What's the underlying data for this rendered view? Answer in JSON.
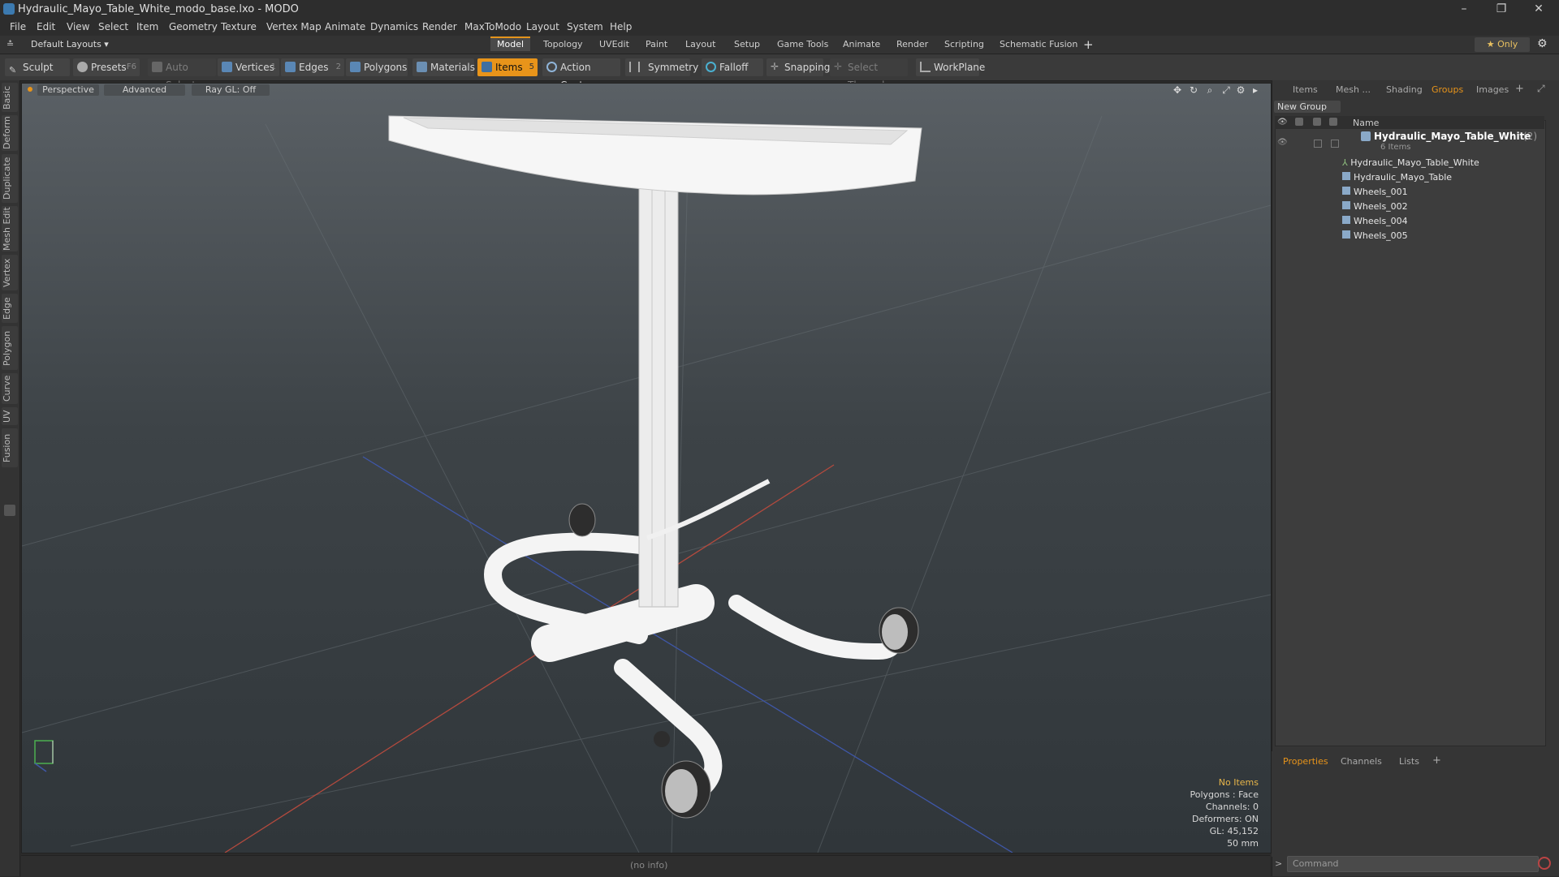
{
  "window": {
    "title": "Hydraulic_Mayo_Table_White_modo_base.lxo - MODO",
    "minimize": "–",
    "restore": "❐",
    "close": "✕"
  },
  "menu": [
    "File",
    "Edit",
    "View",
    "Select",
    "Item",
    "Geometry",
    "Texture",
    "Vertex Map",
    "Animate",
    "Dynamics",
    "Render",
    "MaxToModo",
    "Layout",
    "System",
    "Help"
  ],
  "layout_selector": "Default Layouts ▾",
  "layout_tabs": [
    "Model",
    "Topology",
    "UVEdit",
    "Paint",
    "Layout",
    "Setup",
    "Game Tools",
    "Animate",
    "Render",
    "Scripting",
    "Schematic Fusion"
  ],
  "active_layout_tab": "Model",
  "only_label": "★  Only",
  "toolbar": {
    "sculpt": "Sculpt",
    "presets": "Presets",
    "presets_key": "F6",
    "auto_select": "Auto Select",
    "vertices": "Vertices",
    "vertices_key": "1",
    "edges": "Edges",
    "edges_key": "2",
    "polygons": "Polygons",
    "materials": "Materials",
    "items": "Items",
    "items_key": "5",
    "action_center": "Action Center",
    "symmetry": "Symmetry",
    "falloff": "Falloff",
    "snapping": "Snapping",
    "select_through": "Select Through",
    "workplane": "WorkPlane"
  },
  "left_tabs": [
    "Basic",
    "Deform",
    "Duplicate",
    "Mesh Edit",
    "Vertex",
    "Edge",
    "Polygon",
    "Curve",
    "UV",
    "Fusion"
  ],
  "viewport": {
    "view_mode": "Perspective",
    "shading": "Advanced",
    "raygl": "Ray GL: Off",
    "info": {
      "selection": "No Items",
      "polygons": "Polygons : Face",
      "channels": "Channels: 0",
      "deformers": "Deformers: ON",
      "gl": "GL: 45,152",
      "focal": "50 mm"
    }
  },
  "right_panel": {
    "tabs": [
      "Items",
      "Mesh ...",
      "Shading",
      "Groups",
      "Images"
    ],
    "active_tab": "Groups",
    "new_group": "New Group",
    "column_name": "Name",
    "group_name": "Hydraulic_Mayo_Table_White",
    "group_count": "(2)",
    "group_sub": "6 Items",
    "items": [
      "Hydraulic_Mayo_Table_White",
      "Hydraulic_Mayo_Table",
      "Wheels_001",
      "Wheels_002",
      "Wheels_004",
      "Wheels_005"
    ],
    "bottom_tabs": [
      "Properties",
      "Channels",
      "Lists"
    ],
    "bottom_active": "Properties"
  },
  "status": {
    "info": "(no info)",
    "command_placeholder": "Command"
  },
  "colors": {
    "accent": "#e8941a",
    "panel": "#353535",
    "viewport_top": "#5a6065",
    "viewport_bottom": "#30363a"
  }
}
